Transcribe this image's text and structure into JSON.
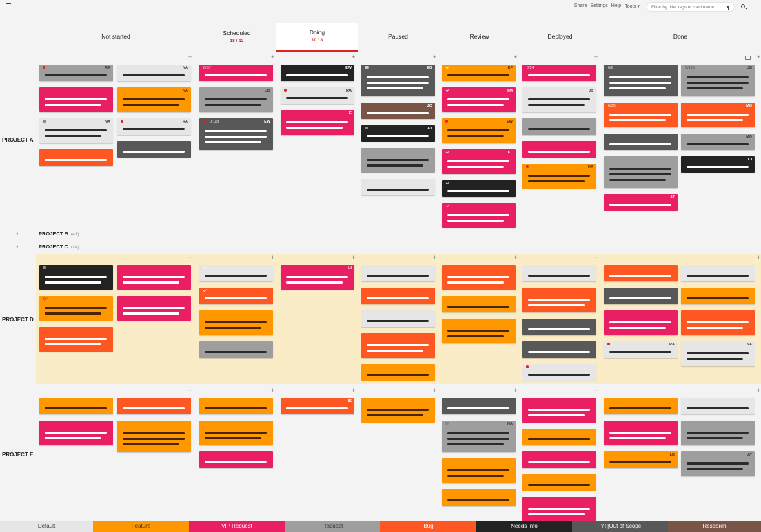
{
  "topbar": {
    "links": [
      "Share",
      "Settings",
      "Help",
      "Tools ▾"
    ],
    "search_placeholder": "Filter by title, tags or card name"
  },
  "columns": [
    {
      "key": "not_started",
      "label": "Not started",
      "sub": ""
    },
    {
      "key": "scheduled",
      "label": "Scheduled",
      "sub": "18 / 12"
    },
    {
      "key": "doing",
      "label": "Doing",
      "sub": "10 / 8",
      "active": true
    },
    {
      "key": "paused",
      "label": "Paused",
      "sub": ""
    },
    {
      "key": "review",
      "label": "Review",
      "sub": ""
    },
    {
      "key": "deployed",
      "label": "Deployed",
      "sub": ""
    },
    {
      "key": "done",
      "label": "Done",
      "sub": ""
    }
  ],
  "colors": {
    "default": "#e6e6e6",
    "feature": "#ff9800",
    "vip": "#e91e63",
    "request": "#9e9e9e",
    "bug": "#ff5722",
    "needs_info": "#222222",
    "fyi": "#585858",
    "research": "#795548"
  },
  "lanes": [
    {
      "name": "PROJECT A",
      "cards": [
        {
          "col": "ns",
          "sub": 0,
          "row": 0,
          "h": 24,
          "type": "request",
          "lines": [
            1
          ],
          "initials": "RA",
          "icon": "pin"
        },
        {
          "col": "ns",
          "sub": 1,
          "row": 0,
          "h": 24,
          "type": "default",
          "lines": [
            1
          ],
          "initials": "NA"
        },
        {
          "col": "ns",
          "sub": 0,
          "row": 1,
          "h": 36,
          "type": "vip",
          "lines": [
            2
          ]
        },
        {
          "col": "ns",
          "sub": 1,
          "row": 1,
          "h": 36,
          "type": "feature",
          "lines": [
            2
          ],
          "initials": "NA"
        },
        {
          "col": "ns",
          "sub": 0,
          "row": 2,
          "h": 36,
          "type": "default",
          "lines": [
            2
          ],
          "initials": "NA",
          "icon": "tag"
        },
        {
          "col": "ns",
          "sub": 1,
          "row": 2,
          "h": 24,
          "type": "default",
          "lines": [
            1
          ],
          "initials": "RA",
          "icon": "pin"
        },
        {
          "col": "ns",
          "sub": 0,
          "row": 3,
          "h": 24,
          "type": "bug",
          "lines": [
            1
          ]
        },
        {
          "col": "ns",
          "sub": 1,
          "row": 3,
          "h": 24,
          "type": "fyi",
          "lines": [
            1
          ]
        },
        {
          "col": "sch",
          "row": 0,
          "h": 24,
          "type": "vip",
          "lines": [
            1
          ],
          "counter": "0/57"
        },
        {
          "col": "sch",
          "row": 1,
          "h": 36,
          "type": "request",
          "lines": [
            2
          ],
          "initials": "JB"
        },
        {
          "col": "sch",
          "row": 2,
          "h": 46,
          "type": "fyi",
          "lines": [
            3
          ],
          "initials": "EW",
          "counter": "0/118",
          "icon": "pin"
        },
        {
          "col": "doing",
          "row": 0,
          "h": 24,
          "type": "needs_info",
          "lines": [
            1
          ],
          "initials": "EW"
        },
        {
          "col": "doing",
          "row": 1,
          "h": 24,
          "type": "default",
          "lines": [
            1
          ],
          "initials": "RA",
          "icon": "pin"
        },
        {
          "col": "doing",
          "row": 2,
          "h": 36,
          "type": "vip",
          "lines": [
            2
          ],
          "initials": "E"
        },
        {
          "col": "paused",
          "row": 0,
          "h": 46,
          "type": "fyi",
          "lines": [
            3
          ],
          "initials": "EG",
          "icon": "comment"
        },
        {
          "col": "paused",
          "row": 1,
          "h": 24,
          "type": "research",
          "lines": [
            1
          ],
          "initials": "JO"
        },
        {
          "col": "paused",
          "row": 2,
          "h": 24,
          "type": "needs_info",
          "lines": [
            1
          ],
          "initials": "AT",
          "icon": "tag"
        },
        {
          "col": "paused",
          "row": 3,
          "h": 36,
          "type": "request",
          "lines": [
            2
          ]
        },
        {
          "col": "paused",
          "row": 4,
          "h": 24,
          "type": "default",
          "lines": [
            1
          ]
        },
        {
          "col": "review",
          "row": 0,
          "h": 24,
          "type": "feature",
          "lines": [
            1
          ],
          "initials": "KF",
          "icon": "check"
        },
        {
          "col": "review",
          "row": 1,
          "h": 36,
          "type": "vip",
          "lines": [
            2
          ],
          "initials": "MM",
          "icon": "check"
        },
        {
          "col": "review",
          "row": 2,
          "h": 36,
          "type": "feature",
          "lines": [
            2
          ],
          "initials": "EW",
          "icon": "pin"
        },
        {
          "col": "review",
          "row": 3,
          "h": 36,
          "type": "vip",
          "lines": [
            2
          ],
          "initials": "KL",
          "icon": "check"
        },
        {
          "col": "review",
          "row": 4,
          "h": 24,
          "type": "needs_info",
          "lines": [
            1
          ],
          "icon": "check"
        },
        {
          "col": "review",
          "row": 5,
          "h": 36,
          "type": "vip",
          "lines": [
            2
          ],
          "icon": "check"
        },
        {
          "col": "deployed",
          "row": 0,
          "h": 24,
          "type": "vip",
          "lines": [
            1
          ],
          "counter": "0/24"
        },
        {
          "col": "deployed",
          "row": 1,
          "h": 36,
          "type": "default",
          "lines": [
            2
          ],
          "initials": "JB"
        },
        {
          "col": "deployed",
          "row": 2,
          "h": 24,
          "type": "request",
          "lines": [
            1
          ]
        },
        {
          "col": "deployed",
          "row": 3,
          "h": 24,
          "type": "vip",
          "lines": [
            1
          ]
        },
        {
          "col": "deployed",
          "row": 4,
          "h": 36,
          "type": "feature",
          "lines": [
            2
          ],
          "initials": "RA",
          "icon": "pin"
        },
        {
          "col": "done",
          "sub": 0,
          "row": 0,
          "h": 46,
          "type": "fyi",
          "lines": [
            3
          ],
          "counter": "0/6"
        },
        {
          "col": "done",
          "sub": 1,
          "row": 0,
          "h": 46,
          "type": "request",
          "lines": [
            3
          ],
          "initials": "JB",
          "counter": "0/135"
        },
        {
          "col": "done",
          "sub": 0,
          "row": 1,
          "h": 36,
          "type": "bug",
          "lines": [
            2
          ],
          "counter": "0/30"
        },
        {
          "col": "done",
          "sub": 1,
          "row": 1,
          "h": 36,
          "type": "bug",
          "lines": [
            2
          ],
          "initials": "MO"
        },
        {
          "col": "done",
          "sub": 0,
          "row": 2,
          "h": 24,
          "type": "fyi",
          "lines": [
            1
          ]
        },
        {
          "col": "done",
          "sub": 1,
          "row": 2,
          "h": 24,
          "type": "request",
          "lines": [
            1
          ],
          "initials": "MO"
        },
        {
          "col": "done",
          "sub": 0,
          "row": 3,
          "h": 46,
          "type": "request",
          "lines": [
            3
          ]
        },
        {
          "col": "done",
          "sub": 1,
          "row": 3,
          "h": 24,
          "type": "needs_info",
          "lines": [
            1
          ],
          "initials": "LJ"
        },
        {
          "col": "done",
          "sub": 0,
          "row": 4,
          "h": 24,
          "type": "vip",
          "lines": [
            1
          ],
          "initials": "AT"
        }
      ]
    },
    {
      "name": "PROJECT B",
      "collapsed": true,
      "count": "(41)"
    },
    {
      "name": "PROJECT C",
      "collapsed": true,
      "count": "(24)"
    },
    {
      "name": "PROJECT D",
      "highlight": true,
      "cards": [
        {
          "col": "ns",
          "sub": 0,
          "row": 0,
          "h": 36,
          "type": "needs_info",
          "lines": [
            2
          ],
          "icon": "tag"
        },
        {
          "col": "ns",
          "sub": 1,
          "row": 0,
          "h": 36,
          "type": "vip",
          "lines": [
            2
          ]
        },
        {
          "col": "ns",
          "sub": 0,
          "row": 1,
          "h": 36,
          "type": "feature",
          "lines": [
            2
          ],
          "counter": "0/4"
        },
        {
          "col": "ns",
          "sub": 1,
          "row": 1,
          "h": 36,
          "type": "vip",
          "lines": [
            2
          ]
        },
        {
          "col": "ns",
          "sub": 0,
          "row": 2,
          "h": 36,
          "type": "bug",
          "lines": [
            2
          ]
        },
        {
          "col": "sch",
          "row": 0,
          "h": 24,
          "type": "default",
          "lines": [
            1
          ],
          "icon": "check"
        },
        {
          "col": "sch",
          "row": 1,
          "h": 24,
          "type": "bug",
          "lines": [
            1
          ],
          "icon": "check"
        },
        {
          "col": "sch",
          "row": 2,
          "h": 36,
          "type": "feature",
          "lines": [
            2
          ]
        },
        {
          "col": "sch",
          "row": 3,
          "h": 24,
          "type": "request",
          "lines": [
            1
          ]
        },
        {
          "col": "doing",
          "row": 0,
          "h": 36,
          "type": "vip",
          "lines": [
            2
          ],
          "initials": "LI"
        },
        {
          "col": "paused",
          "row": 0,
          "h": 24,
          "type": "default",
          "lines": [
            1
          ]
        },
        {
          "col": "paused",
          "row": 1,
          "h": 24,
          "type": "bug",
          "lines": [
            1
          ]
        },
        {
          "col": "paused",
          "row": 2,
          "h": 24,
          "type": "default",
          "lines": [
            1
          ]
        },
        {
          "col": "paused",
          "row": 3,
          "h": 36,
          "type": "bug",
          "lines": [
            2
          ]
        },
        {
          "col": "paused",
          "row": 4,
          "h": 24,
          "type": "feature",
          "lines": [
            1
          ]
        },
        {
          "col": "review",
          "row": 0,
          "h": 36,
          "type": "bug",
          "lines": [
            2
          ]
        },
        {
          "col": "review",
          "row": 1,
          "h": 24,
          "type": "feature",
          "lines": [
            1
          ]
        },
        {
          "col": "review",
          "row": 2,
          "h": 36,
          "type": "feature",
          "lines": [
            2
          ]
        },
        {
          "col": "deployed",
          "row": 0,
          "h": 24,
          "type": "default",
          "lines": [
            1
          ]
        },
        {
          "col": "deployed",
          "row": 1,
          "h": 36,
          "type": "bug",
          "lines": [
            2
          ]
        },
        {
          "col": "deployed",
          "row": 2,
          "h": 24,
          "type": "fyi",
          "lines": [
            1
          ]
        },
        {
          "col": "deployed",
          "row": 3,
          "h": 24,
          "type": "fyi",
          "lines": [
            1
          ]
        },
        {
          "col": "deployed",
          "row": 4,
          "h": 24,
          "type": "default",
          "lines": [
            1
          ],
          "icon": "pin"
        },
        {
          "col": "done",
          "sub": 0,
          "row": 0,
          "h": 24,
          "type": "bug",
          "lines": [
            1
          ]
        },
        {
          "col": "done",
          "sub": 1,
          "row": 0,
          "h": 24,
          "type": "default",
          "lines": [
            1
          ]
        },
        {
          "col": "done",
          "sub": 0,
          "row": 1,
          "h": 24,
          "type": "fyi",
          "lines": [
            1
          ]
        },
        {
          "col": "done",
          "sub": 1,
          "row": 1,
          "h": 24,
          "type": "feature",
          "lines": [
            1
          ]
        },
        {
          "col": "done",
          "sub": 0,
          "row": 2,
          "h": 36,
          "type": "vip",
          "lines": [
            2
          ]
        },
        {
          "col": "done",
          "sub": 1,
          "row": 2,
          "h": 36,
          "type": "bug",
          "lines": [
            2
          ]
        },
        {
          "col": "done",
          "sub": 0,
          "row": 3,
          "h": 24,
          "type": "default",
          "lines": [
            1
          ],
          "initials": "RA",
          "icon": "pin"
        },
        {
          "col": "done",
          "sub": 1,
          "row": 3,
          "h": 36,
          "type": "default",
          "lines": [
            2
          ],
          "initials": "NA"
        }
      ]
    },
    {
      "name": "PROJECT E",
      "cards": [
        {
          "col": "ns",
          "sub": 0,
          "row": 0,
          "h": 24,
          "type": "feature",
          "lines": [
            1
          ]
        },
        {
          "col": "ns",
          "sub": 1,
          "row": 0,
          "h": 24,
          "type": "bug",
          "lines": [
            1
          ]
        },
        {
          "col": "ns",
          "sub": 0,
          "row": 1,
          "h": 36,
          "type": "vip",
          "lines": [
            2
          ]
        },
        {
          "col": "ns",
          "sub": 1,
          "row": 1,
          "h": 46,
          "type": "feature",
          "lines": [
            3
          ]
        },
        {
          "col": "sch",
          "row": 0,
          "h": 24,
          "type": "feature",
          "lines": [
            1
          ]
        },
        {
          "col": "sch",
          "row": 1,
          "h": 36,
          "type": "feature",
          "lines": [
            2
          ]
        },
        {
          "col": "sch",
          "row": 2,
          "h": 24,
          "type": "vip",
          "lines": [
            1
          ]
        },
        {
          "col": "doing",
          "row": 0,
          "h": 24,
          "type": "bug",
          "lines": [
            1
          ],
          "initials": "IS"
        },
        {
          "col": "paused",
          "row": 0,
          "h": 36,
          "type": "feature",
          "lines": [
            2
          ]
        },
        {
          "col": "review",
          "row": 0,
          "h": 24,
          "type": "fyi",
          "lines": [
            1
          ]
        },
        {
          "col": "review",
          "row": 1,
          "h": 46,
          "type": "request",
          "lines": [
            3
          ],
          "initials": "NA",
          "icon": "tag"
        },
        {
          "col": "review",
          "row": 2,
          "h": 36,
          "type": "feature",
          "lines": [
            2
          ]
        },
        {
          "col": "review",
          "row": 3,
          "h": 24,
          "type": "feature",
          "lines": [
            1
          ]
        },
        {
          "col": "deployed",
          "row": 0,
          "h": 36,
          "type": "vip",
          "lines": [
            2
          ]
        },
        {
          "col": "deployed",
          "row": 1,
          "h": 24,
          "type": "feature",
          "lines": [
            1
          ]
        },
        {
          "col": "deployed",
          "row": 2,
          "h": 24,
          "type": "vip",
          "lines": [
            1
          ]
        },
        {
          "col": "deployed",
          "row": 3,
          "h": 24,
          "type": "feature",
          "lines": [
            1
          ]
        },
        {
          "col": "deployed",
          "row": 4,
          "h": 36,
          "type": "vip",
          "lines": [
            2
          ]
        },
        {
          "col": "done",
          "sub": 0,
          "row": 0,
          "h": 24,
          "type": "feature",
          "lines": [
            1
          ]
        },
        {
          "col": "done",
          "sub": 1,
          "row": 0,
          "h": 24,
          "type": "default",
          "lines": [
            1
          ]
        },
        {
          "col": "done",
          "sub": 0,
          "row": 1,
          "h": 36,
          "type": "vip",
          "lines": [
            2
          ]
        },
        {
          "col": "done",
          "sub": 1,
          "row": 1,
          "h": 36,
          "type": "request",
          "lines": [
            2
          ]
        },
        {
          "col": "done",
          "sub": 0,
          "row": 2,
          "h": 24,
          "type": "feature",
          "lines": [
            1
          ],
          "initials": "LB"
        },
        {
          "col": "done",
          "sub": 1,
          "row": 2,
          "h": 36,
          "type": "request",
          "lines": [
            2
          ],
          "initials": "AT"
        }
      ]
    }
  ],
  "legend": [
    {
      "key": "default",
      "label": "Default",
      "color": "#e6e6e6",
      "text": "#333333"
    },
    {
      "key": "feature",
      "label": "Feature",
      "color": "#ff9800",
      "text": "#333333"
    },
    {
      "key": "vip",
      "label": "VIP Request",
      "color": "#e91e63",
      "text": "#ffffff"
    },
    {
      "key": "request",
      "label": "Request",
      "color": "#9e9e9e",
      "text": "#333333"
    },
    {
      "key": "bug",
      "label": "Bug",
      "color": "#ff5722",
      "text": "#ffffff"
    },
    {
      "key": "needs_info",
      "label": "Needs Info",
      "color": "#222222",
      "text": "#ffffff"
    },
    {
      "key": "fyi",
      "label": "FYI [Out of Scope]",
      "color": "#585858",
      "text": "#ffffff"
    },
    {
      "key": "research",
      "label": "Research",
      "color": "#795548",
      "text": "#ffffff"
    }
  ]
}
